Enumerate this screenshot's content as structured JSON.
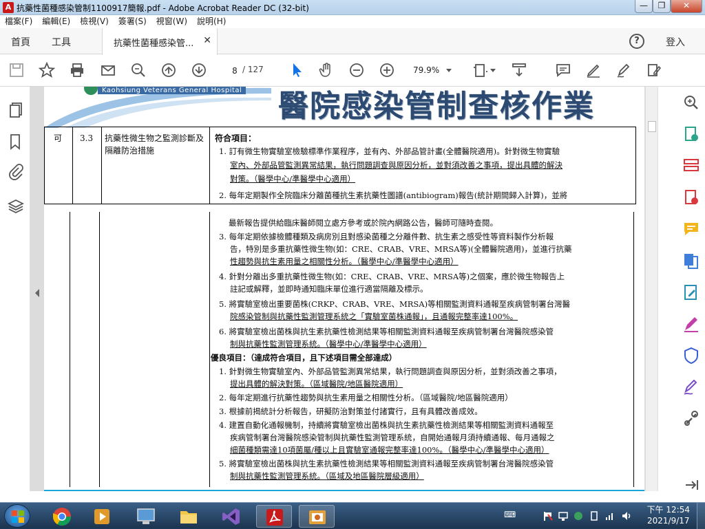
{
  "window": {
    "title": "抗藥性菌種感染管制1100917簡報.pdf - Adobe Acrobat Reader DC (32-bit)",
    "controls": [
      "—",
      "❐",
      "✕"
    ]
  },
  "menu": [
    "檔案(F)",
    "編輯(E)",
    "檢視(V)",
    "簽署(S)",
    "視窗(W)",
    "說明(H)"
  ],
  "tabs": {
    "home": "首頁",
    "tools": "工具",
    "doc": "抗藥性菌種感染管...",
    "close": "✕",
    "help": "?",
    "login": "登入"
  },
  "toolbar": {
    "page_current": "8",
    "page_total": "/ 127",
    "zoom": "79.9%"
  },
  "page": {
    "hospital_en": "Kaohsiung Veterans General Hospital",
    "header_title": "醫院感染管制查核作業",
    "row": {
      "grade": "可",
      "number": "3.3",
      "item": "抗藥性微生物之監測診斷及隔離防治措施",
      "section1": "符合項目："
    },
    "lines_top": [
      "1. 訂有微生物實驗室檢驗標準作業程序，並有內、外部品管計畫(全體醫院適用)。針對微生物實驗",
      "室內、外部品管監測異常結果，執行問題調查與原因分析，並對須改善之事項，提出具體的解決",
      "對策。（醫學中心/準醫學中心適用）",
      "2. 每年定期製作全院臨床分離菌種抗生素抗藥性圖譜(antibiogram)報告(統計期間歸入計算)，並將"
    ],
    "lines_bottom": [
      "最新報告提供給臨床醫師閱立處方參考或於院內網路公告，醫師可隨時查閱。",
      "3. 每年定期依據檢體種類及病房別且對感染菌種之分離件數、抗生素之感受性等資料製作分析報",
      "告，特別是多重抗藥性微生物(如：CRE、CRAB、VRE、MRSA等)(全體醫院適用)，並進行抗藥",
      "性趨勢與抗生素用量之相關性分析。（醫學中心/準醫學中心適用）",
      "4. 針對分離出多重抗藥性微生物(如：CRE、CRAB、VRE、MRSA等)之個案，應於微生物報告上",
      "註記或解釋，並即時通知臨床單位進行適當隔離及標示。",
      "5. 將實驗室檢出重要菌株(CRKP、CRAB、VRE、MRSA)等相關監測資料通報至疾病管制署台灣醫",
      "院感染管制與抗藥性監測管理系統之「實驗室菌株通報」，且通報完整率達100%。",
      "6. 將實驗室檢出菌株與抗生素抗藥性檢測結果等相關監測資料通報至疾病管制署台灣醫院感染管",
      "制與抗藥性監測管理系統。（醫學中心/準醫學中心適用）",
      "優良項目：（達成符合項目，且下述項目需全部達成）",
      "1. 針對微生物實驗室內、外部品管監測異常結果，執行問題調查與原因分析，並對須改善之事項，",
      "提出具體的解決對策。（區域醫院/地區醫院適用）",
      "2. 每年定期進行抗藥性趨勢與抗生素用量之相關性分析。（區域醫院/地區醫院適用）",
      "3. 根據前揭統計分析報告，研擬防治對策並付諸實行，且有具體改善成效。",
      "4. 建置自動化通報機制，持續將實驗室檢出菌株與抗生素抗藥性檢測結果等相關監測資料通報至",
      "疾病管制署台灣醫院感染管制與抗藥性監測管理系統，自開始通報月須持續通報、每月通報之",
      "細菌種類需達10項菌屬/種以上且實驗室通報完整率達100%。（醫學中心/準醫學中心適用）",
      "5. 將實驗室檢出菌株與抗生素抗藥性檢測結果等相關監測資料通報至疾病管制署台灣醫院感染管",
      "制與抗藥性監測管理系統。（區域及地區醫院層級適用）"
    ]
  },
  "taskbar": {
    "lang": "⌨",
    "time": "下午 12:54",
    "date": "2021/9/17"
  },
  "colors": {
    "accent": "#1473e6",
    "header_blue": "#2c4a72",
    "taskbar": "#1c3550",
    "pdf_red": "#c8191b"
  }
}
